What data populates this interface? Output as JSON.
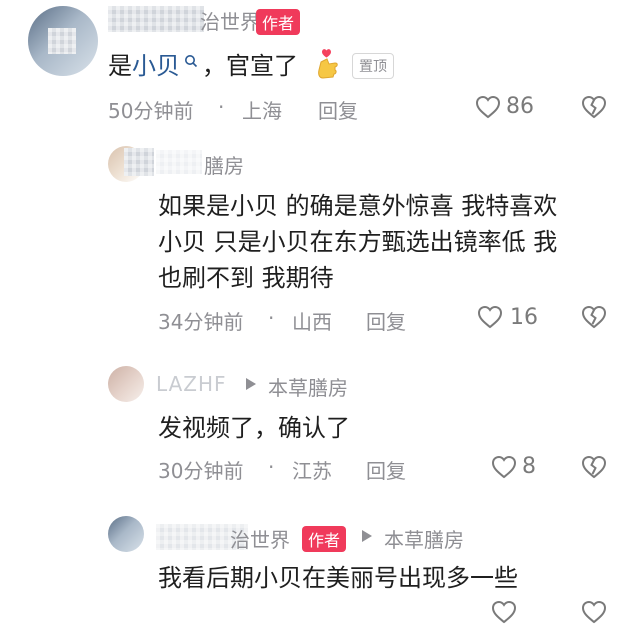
{
  "comments": [
    {
      "author_suffix": "治世界",
      "badge": "作者",
      "text_prefix": "是",
      "text_link": "小贝",
      "text_suffix": "，官宣了",
      "pin": "置顶",
      "time": "50分钟前",
      "location": "上海",
      "reply": "回复",
      "likes": "86"
    },
    {
      "author_suffix": "膳房",
      "lines": [
        "如果是小贝  的确是意外惊喜  我特喜欢",
        "小贝 只是小贝在东方甄选出镜率低 我",
        "也刷不到   我期待"
      ],
      "time": "34分钟前",
      "location": "山西",
      "reply": "回复",
      "likes": "16"
    },
    {
      "author_obscured": "LAZHF",
      "target": "本草膳房",
      "text": "发视频了，确认了",
      "time": "30分钟前",
      "location": "江苏",
      "reply": "回复",
      "likes": "8"
    },
    {
      "author_suffix": "治世界",
      "badge": "作者",
      "target": "本草膳房",
      "text": "我看后期小贝在美丽号出现多一些"
    }
  ],
  "separator": "·",
  "icons": [
    "heart-icon",
    "broken-heart-icon",
    "reply-arrow-icon",
    "search-icon",
    "finger-heart-emoji"
  ],
  "colors": {
    "badge": "#f03a5b",
    "link": "#2a5a94",
    "meta": "#8f8f94"
  }
}
